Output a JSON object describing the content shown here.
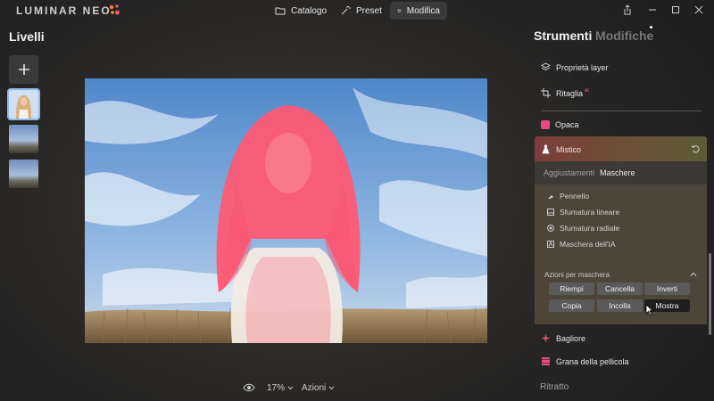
{
  "app": {
    "logo_text": "LUMINAR NEO"
  },
  "nav": {
    "catalog": "Catalogo",
    "presets": "Preset",
    "edit": "Modifica"
  },
  "layers": {
    "title": "Livelli"
  },
  "bottom": {
    "zoom": "17%",
    "actions": "Azioni"
  },
  "tools_panel": {
    "tab_tools": "Strumenti",
    "tab_favorites": "Modifiche",
    "layer_properties": "Proprietà layer",
    "crop": "Ritaglia",
    "crop_ai_badge": "AI",
    "opaque": "Opaca",
    "mystic": "Mistico",
    "subtab_adjust": "Aggiustamenti",
    "subtab_masks": "Maschere",
    "mask_items": [
      "Pennello",
      "Sfumatura lineare",
      "Sfumatura radiale",
      "Maschera dell'IA"
    ],
    "mask_actions_title": "Azioni per maschera",
    "mask_actions": [
      "Riempi",
      "Cancella",
      "Inverti",
      "Copia",
      "Incolla",
      "Mostra"
    ],
    "glow": "Bagliore",
    "film_grain": "Grana della pellicola",
    "portrait": "Ritratto"
  },
  "colors": {
    "accent_pink": "#e84b84",
    "mask_overlay": "#ff4f6b"
  }
}
